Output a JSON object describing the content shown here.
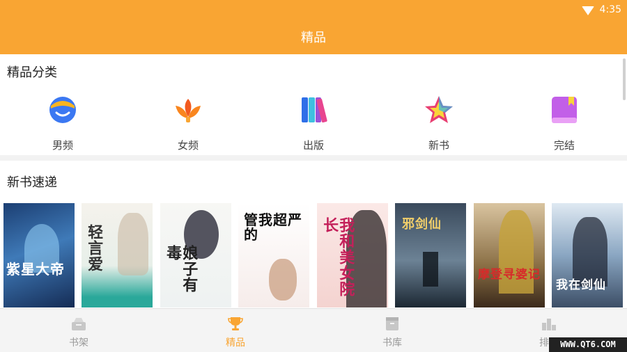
{
  "status_bar": {
    "time": "4:35"
  },
  "header": {
    "title": "精品"
  },
  "categories": {
    "title": "精品分类",
    "items": [
      {
        "label": "男频",
        "icon": "male-face-icon"
      },
      {
        "label": "女频",
        "icon": "lotus-flower-icon"
      },
      {
        "label": "出版",
        "icon": "books-icon"
      },
      {
        "label": "新书",
        "icon": "star-icon"
      },
      {
        "label": "完结",
        "icon": "bookmark-book-icon"
      }
    ]
  },
  "new_books": {
    "title": "新书速递",
    "covers": [
      {
        "title": "紫星大帝"
      },
      {
        "title": "轻言爱"
      },
      {
        "title": "娘子有毒"
      },
      {
        "title": "管我超严的"
      },
      {
        "title": "我和美女院长"
      },
      {
        "title": "邪剑仙"
      },
      {
        "title": "摩登寻婆记"
      },
      {
        "title": "我在剑仙"
      }
    ]
  },
  "tabbar": {
    "items": [
      {
        "label": "书架",
        "icon": "bookshelf-icon"
      },
      {
        "label": "精品",
        "icon": "trophy-icon"
      },
      {
        "label": "书库",
        "icon": "library-box-icon"
      },
      {
        "label": "排行",
        "icon": "ranking-icon"
      }
    ]
  },
  "watermark": "WWW.QT6.COM",
  "colors": {
    "accent": "#f9a533",
    "inactive": "#999999"
  }
}
